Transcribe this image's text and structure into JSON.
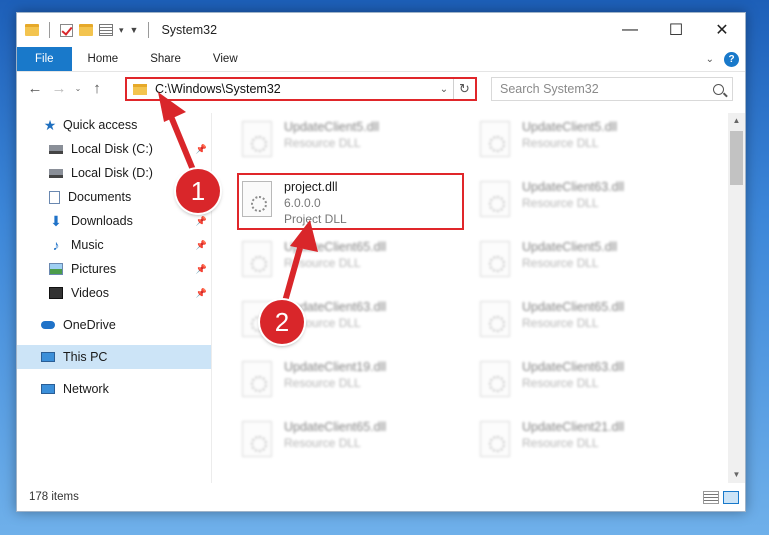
{
  "window": {
    "title": "System32"
  },
  "ribbon": {
    "tabs": [
      "File",
      "Home",
      "Share",
      "View"
    ],
    "help": "?"
  },
  "address": {
    "path": "C:\\Windows\\System32"
  },
  "search": {
    "placeholder": "Search System32"
  },
  "sidebar": {
    "items": [
      {
        "label": "Quick access",
        "icon": "star-icon",
        "pinned": false
      },
      {
        "label": "Local Disk (C:)",
        "icon": "drive-icon",
        "pinned": true
      },
      {
        "label": "Local Disk (D:)",
        "icon": "drive-icon",
        "pinned": true
      },
      {
        "label": "Documents",
        "icon": "documents-icon",
        "pinned": true
      },
      {
        "label": "Downloads",
        "icon": "download-icon",
        "pinned": true
      },
      {
        "label": "Music",
        "icon": "music-icon",
        "pinned": true
      },
      {
        "label": "Pictures",
        "icon": "pictures-icon",
        "pinned": true
      },
      {
        "label": "Videos",
        "icon": "video-icon",
        "pinned": true
      },
      {
        "label": "OneDrive",
        "icon": "cloud-icon",
        "pinned": false
      },
      {
        "label": "This PC",
        "icon": "computer-icon",
        "pinned": false,
        "selected": true
      },
      {
        "label": "Network",
        "icon": "network-icon",
        "pinned": false
      }
    ]
  },
  "files": {
    "highlighted": {
      "name": "project.dll",
      "version": "6.0.0.0",
      "description": "Project DLL"
    },
    "left_column": [
      {
        "name": "UpdateClient5.dll",
        "type": "Resource DLL"
      },
      {
        "name": "UpdateClient65.dll",
        "type": "Resource DLL"
      },
      {
        "name": "UpdateClient63.dll",
        "type": "Resource DLL"
      },
      {
        "name": "UpdateClient19.dll",
        "type": "Resource DLL"
      },
      {
        "name": "UpdateClient65.dll",
        "type": "Resource DLL"
      }
    ],
    "right_column": [
      {
        "name": "UpdateClient5.dll",
        "type": "Resource DLL"
      },
      {
        "name": "UpdateClient63.dll",
        "type": "Resource DLL"
      },
      {
        "name": "UpdateClient5.dll",
        "type": "Resource DLL"
      },
      {
        "name": "UpdateClient65.dll",
        "type": "Resource DLL"
      },
      {
        "name": "UpdateClient63.dll",
        "type": "Resource DLL"
      },
      {
        "name": "UpdateClient21.dll",
        "type": "Resource DLL"
      }
    ]
  },
  "status": {
    "item_count": "178 items"
  },
  "annotations": {
    "step1": "1",
    "step2": "2",
    "color": "#d9262a"
  }
}
